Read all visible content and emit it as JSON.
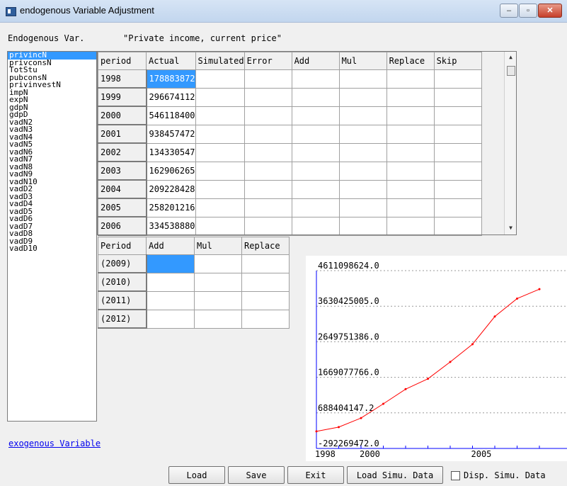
{
  "window": {
    "title": "endogenous Variable Adjustment",
    "min": "‒",
    "max": "▫",
    "close": "✕"
  },
  "endog_label": "Endogenous Var.",
  "endog_desc": "\"Private income, current price\"",
  "variables": [
    "privincN",
    "privconsN",
    "TotStu",
    "pubconsN",
    "privinvestN",
    "impN",
    "expN",
    "gdpN",
    "gdpD",
    "vadN2",
    "vadN3",
    "vadN4",
    "vadN5",
    "vadN6",
    "vadN7",
    "vadN8",
    "vadN9",
    "vadN10",
    "vadD2",
    "vadD3",
    "vadD4",
    "vadD5",
    "vadD6",
    "vadD7",
    "vadD8",
    "vadD9",
    "vadD10"
  ],
  "table1": {
    "headers": [
      "period",
      "Actual",
      "Simulated",
      "Error",
      "Add",
      "Mul",
      "Replace",
      "Skip"
    ],
    "rows": [
      [
        "1998",
        "178883872"
      ],
      [
        "1999",
        "296674112"
      ],
      [
        "2000",
        "546118400"
      ],
      [
        "2001",
        "938457472"
      ],
      [
        "2002",
        "134330547"
      ],
      [
        "2003",
        "162906265"
      ],
      [
        "2004",
        "209228428"
      ],
      [
        "2005",
        "258201216"
      ],
      [
        "2006",
        "334538880"
      ]
    ]
  },
  "table2": {
    "headers": [
      "Period",
      "Add",
      "Mul",
      "Replace"
    ],
    "rows": [
      "(2009)",
      "(2010)",
      "(2011)",
      "(2012)"
    ]
  },
  "chart_data": {
    "type": "line",
    "y_ticks": [
      "4611098624.0",
      "3630425005.0",
      "2649751386.0",
      "1669077766.0",
      "688404147.2",
      "-292269472.0"
    ],
    "y_tick_values": [
      4611098624.0,
      3630425005.0,
      2649751386.0,
      1669077766.0,
      688404147.2,
      -292269472.0
    ],
    "x_ticks": [
      "1998",
      "2000",
      "2005"
    ],
    "x_tick_values": [
      1998,
      2000,
      2005
    ],
    "x": [
      1998,
      1999,
      2000,
      2001,
      2002,
      2003,
      2004,
      2005,
      2006,
      2007,
      2008
    ],
    "values": [
      178883872,
      296674112,
      546118400,
      938457472,
      1343305470,
      1629062650,
      2092284280,
      2582012160,
      3345388800,
      3840000000,
      4100000000
    ],
    "ylim": [
      -292269472.0,
      4611098624.0
    ],
    "xlim": [
      1998,
      2008
    ],
    "color": "#ff0000",
    "grid": "dashed horizontal"
  },
  "exog_link": "exogenous Variable",
  "buttons": {
    "load": "Load",
    "save": "Save",
    "exit": "Exit",
    "load_simu": "Load Simu. Data"
  },
  "checkbox_label": "Disp. Simu. Data"
}
